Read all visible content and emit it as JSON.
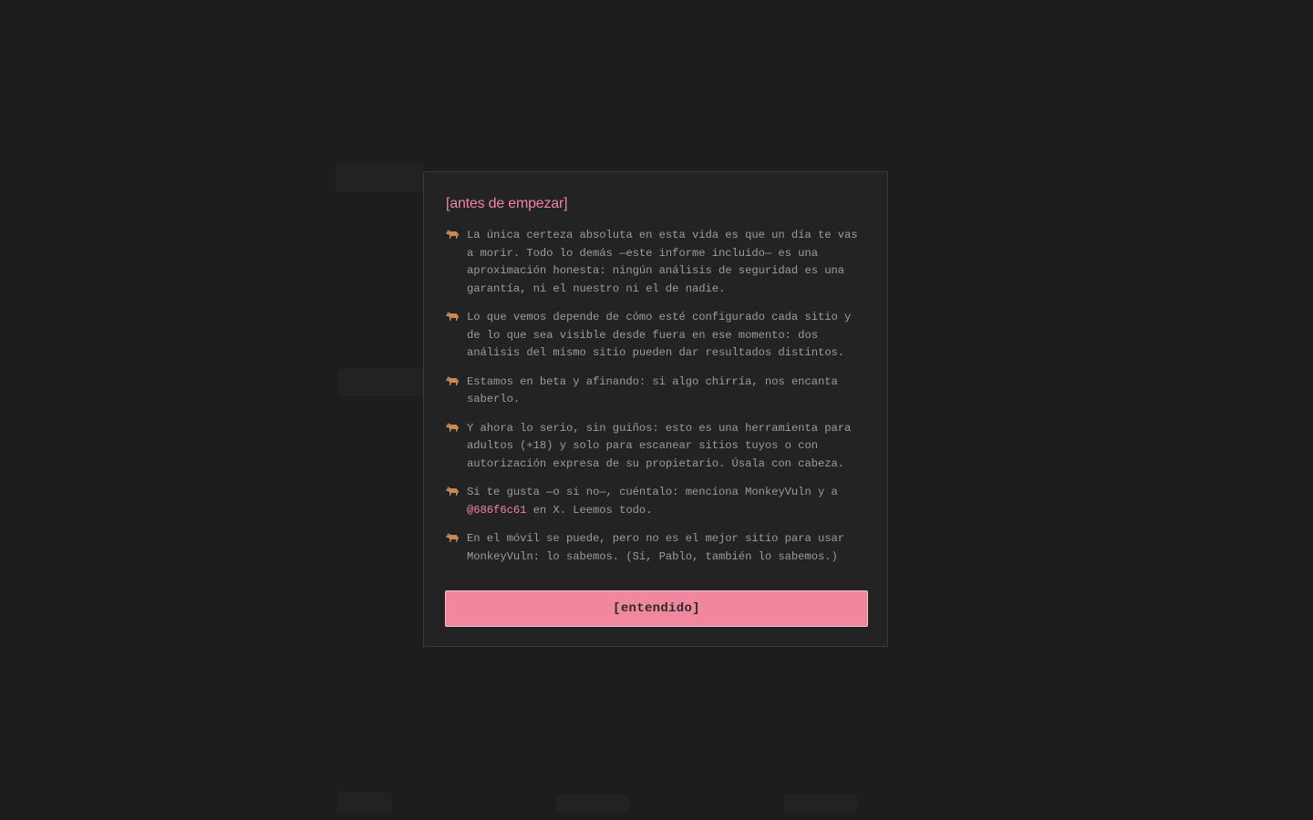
{
  "modal": {
    "title": "[antes de empezar]",
    "notes": [
      {
        "icon": "monkey-icon",
        "text": "La única certeza absoluta en esta vida es que un día te vas a morir. Todo lo demás —este informe incluido— es una aproximación honesta: ningún análisis de seguridad es una garantía, ni el nuestro ni el de nadie."
      },
      {
        "icon": "monkey-icon",
        "text": "Lo que vemos depende de cómo esté configurado cada sitio y de lo que sea visible desde fuera en ese momento: dos análisis del mismo sitio pueden dar resultados distintos."
      },
      {
        "icon": "monkey-icon",
        "text": "Estamos en beta y afinando: si algo chirría, nos encanta saberlo."
      },
      {
        "icon": "monkey-icon",
        "text": "Y ahora lo serio, sin guiños: esto es una herramienta para adultos (+18) y solo para escanear sitios tuyos o con autorización expresa de su propietario. Úsala con cabeza."
      },
      {
        "icon": "monkey-icon",
        "text_before": "Si te gusta —o si no—, cuéntalo: menciona MonkeyVuln y a ",
        "handle": "@686f6c61",
        "text_after": " en X. Leemos todo."
      },
      {
        "icon": "monkey-icon",
        "text": "En el móvil se puede, pero no es el mejor sitio para usar MonkeyVuln: lo sabemos. (Sí, Pablo, también lo sabemos.)"
      }
    ],
    "button_label": "[entendido]"
  },
  "colors": {
    "accent": "#f0859f",
    "button_bg": "#f0879f",
    "modal_bg": "#232323",
    "backdrop": "#1d1d1d",
    "text": "#9c9c9c",
    "icon": "#c98a52"
  }
}
